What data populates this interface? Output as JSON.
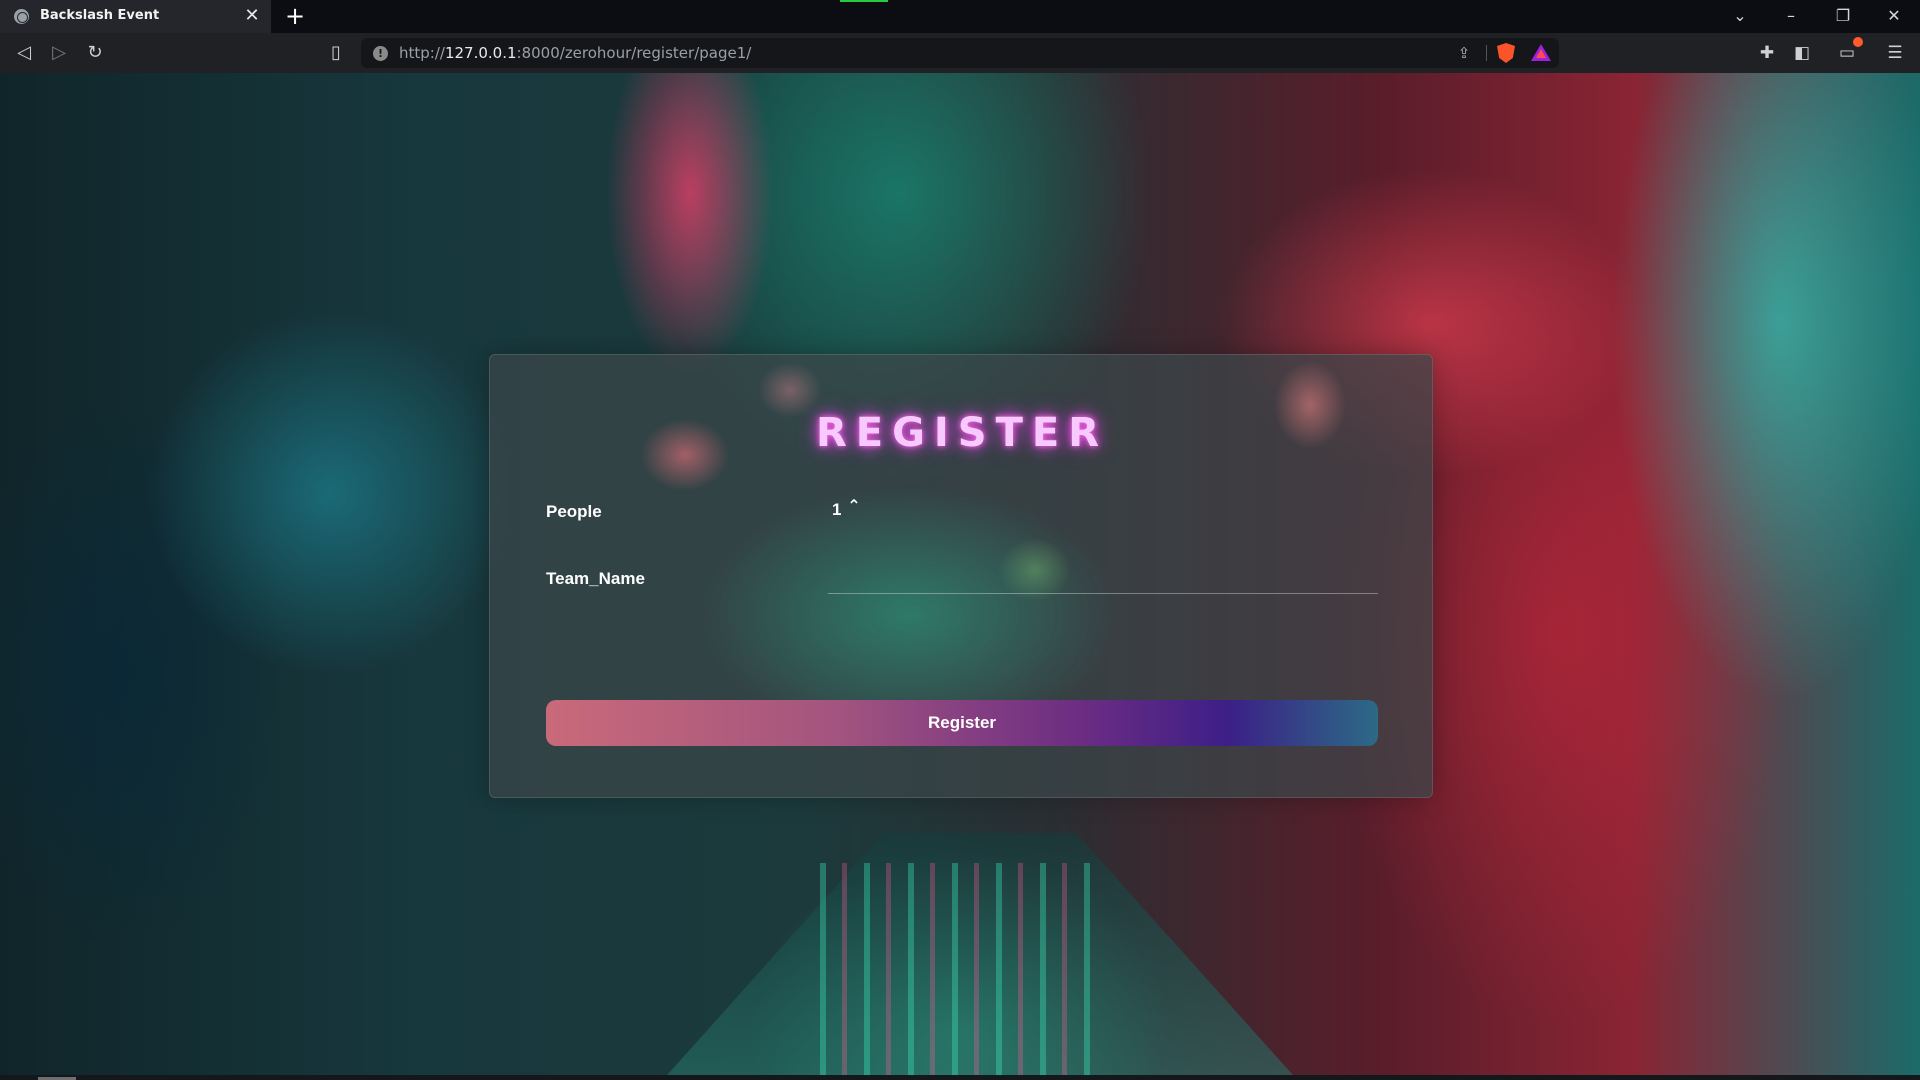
{
  "browser": {
    "tab_title": "Backslash Event",
    "tab_close": "✕",
    "new_tab": "+",
    "url_scheme": "http://",
    "url_host": "127.0.0.1",
    "url_rest": ":8000/zerohour/register/page1/",
    "icons": [
      "back-icon",
      "forward-icon",
      "reload-icon",
      "bookmark-icon",
      "site-info-icon",
      "share-icon",
      "brave-shields-icon",
      "brave-rewards-icon",
      "extensions-icon",
      "sidebar-icon",
      "wallet-icon",
      "menu-icon"
    ]
  },
  "form": {
    "title": "REGISTER",
    "people_label": "People",
    "people_value": "1",
    "team_label": "Team_Name",
    "team_value": "",
    "submit_label": "Register"
  },
  "colors": {
    "title_glow": "#ff6fe6",
    "button_start": "#c96a7a",
    "button_mid": "#6a2c83",
    "button_end": "#2c6a86"
  }
}
